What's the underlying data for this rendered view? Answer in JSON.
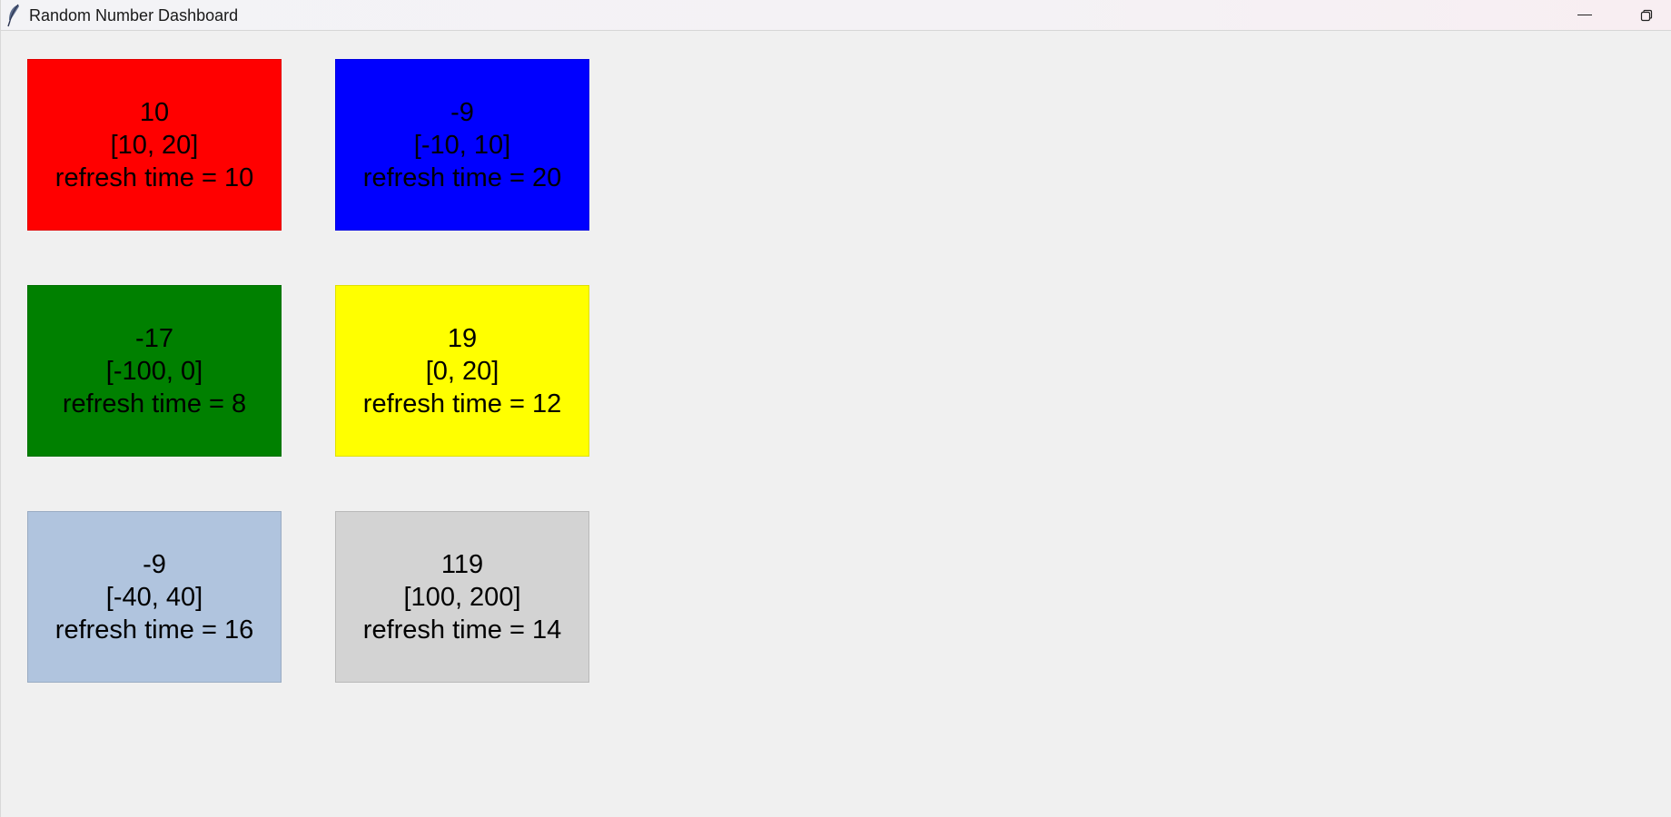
{
  "window": {
    "title": "Random Number Dashboard",
    "icon": "feather-icon",
    "minimize_icon": "minimize-icon",
    "restore_icon": "restore-icon"
  },
  "tiles": [
    {
      "value": "10",
      "range": "[10, 20]",
      "refresh": "refresh time = 10",
      "color": "#ff0000"
    },
    {
      "value": "-9",
      "range": "[-10, 10]",
      "refresh": "refresh time = 20",
      "color": "#0000ff"
    },
    {
      "value": "-17",
      "range": "[-100, 0]",
      "refresh": "refresh time = 8",
      "color": "#008000"
    },
    {
      "value": "19",
      "range": "[0, 20]",
      "refresh": "refresh time = 12",
      "color": "#ffff00"
    },
    {
      "value": "-9",
      "range": "[-40, 40]",
      "refresh": "refresh time = 16",
      "color": "#b0c4de"
    },
    {
      "value": "119",
      "range": "[100, 200]",
      "refresh": "refresh time = 14",
      "color": "#d3d3d3"
    }
  ]
}
